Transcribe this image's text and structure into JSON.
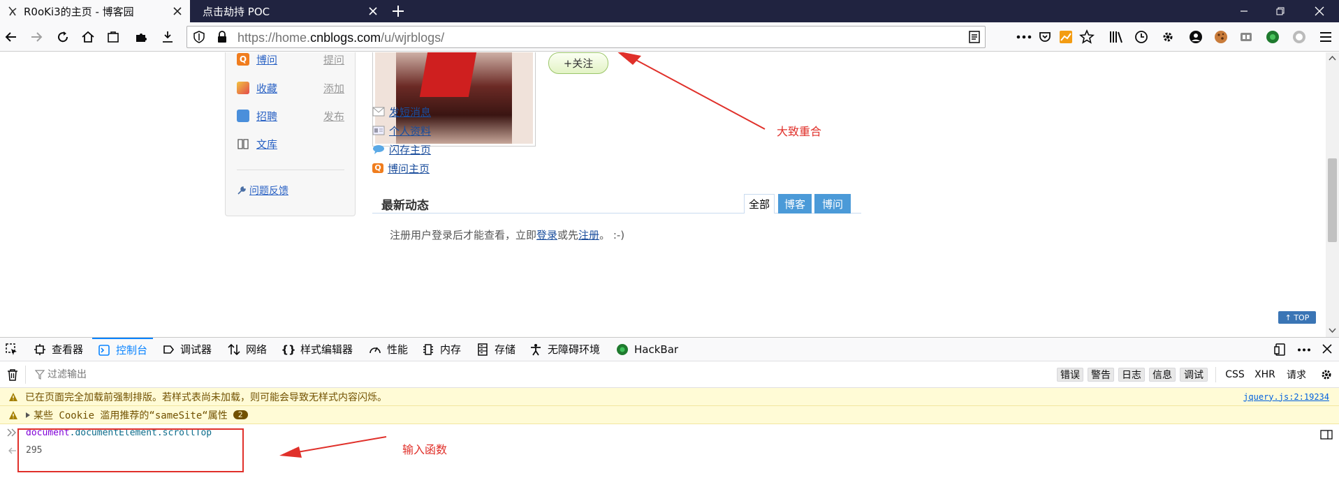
{
  "browser": {
    "tabs": [
      {
        "title": "R0oKi3的主页 - 博客园",
        "active": true
      },
      {
        "title": "点击劫持 POC",
        "active": false
      }
    ],
    "url_prefix": "https://home.",
    "url_domain": "cnblogs.com",
    "url_path": "/u/wjrblogs/"
  },
  "page": {
    "left_menu": [
      {
        "label": "博问",
        "action": "提问"
      },
      {
        "label": "收藏",
        "action": "添加"
      },
      {
        "label": "招聘",
        "action": "发布"
      },
      {
        "label": "文库",
        "action": ""
      }
    ],
    "feedback": "问题反馈",
    "follow_button": "+关注",
    "profile_links": [
      "发短消息",
      "个人资料",
      "闪存主页",
      "博问主页"
    ],
    "feed_title": "最新动态",
    "feed_tabs": [
      "全部",
      "博客",
      "博问"
    ],
    "login_prompt_prefix": "注册用户登录后才能查看，立即",
    "login_link": "登录",
    "login_or": "或先",
    "register_link": "注册",
    "login_prompt_suffix": "。 :-)",
    "top_button": "↑ TOP"
  },
  "annotations": {
    "overlap_note": "大致重合",
    "input_note": "输入函数"
  },
  "devtools": {
    "tabs": [
      "查看器",
      "控制台",
      "调试器",
      "网络",
      "样式编辑器",
      "性能",
      "内存",
      "存储",
      "无障碍环境",
      "HackBar"
    ],
    "active_tab": "控制台",
    "filter_placeholder": "过滤输出",
    "filter_buttons": [
      "错误",
      "警告",
      "日志",
      "信息",
      "调试",
      "CSS",
      "XHR",
      "请求"
    ],
    "warnings": [
      {
        "text": "已在页面完全加载前强制排版。若样式表尚未加载，则可能会导致无样式内容闪烁。",
        "source": "jquery.js:2:19234"
      },
      {
        "text": "某些 Cookie 滥用推荐的“sameSite“属性",
        "count": "2"
      }
    ],
    "console_input_obj": "document",
    "console_input_prop1": ".documentElement",
    "console_input_prop2": ".scrollTop",
    "console_output": "295"
  }
}
